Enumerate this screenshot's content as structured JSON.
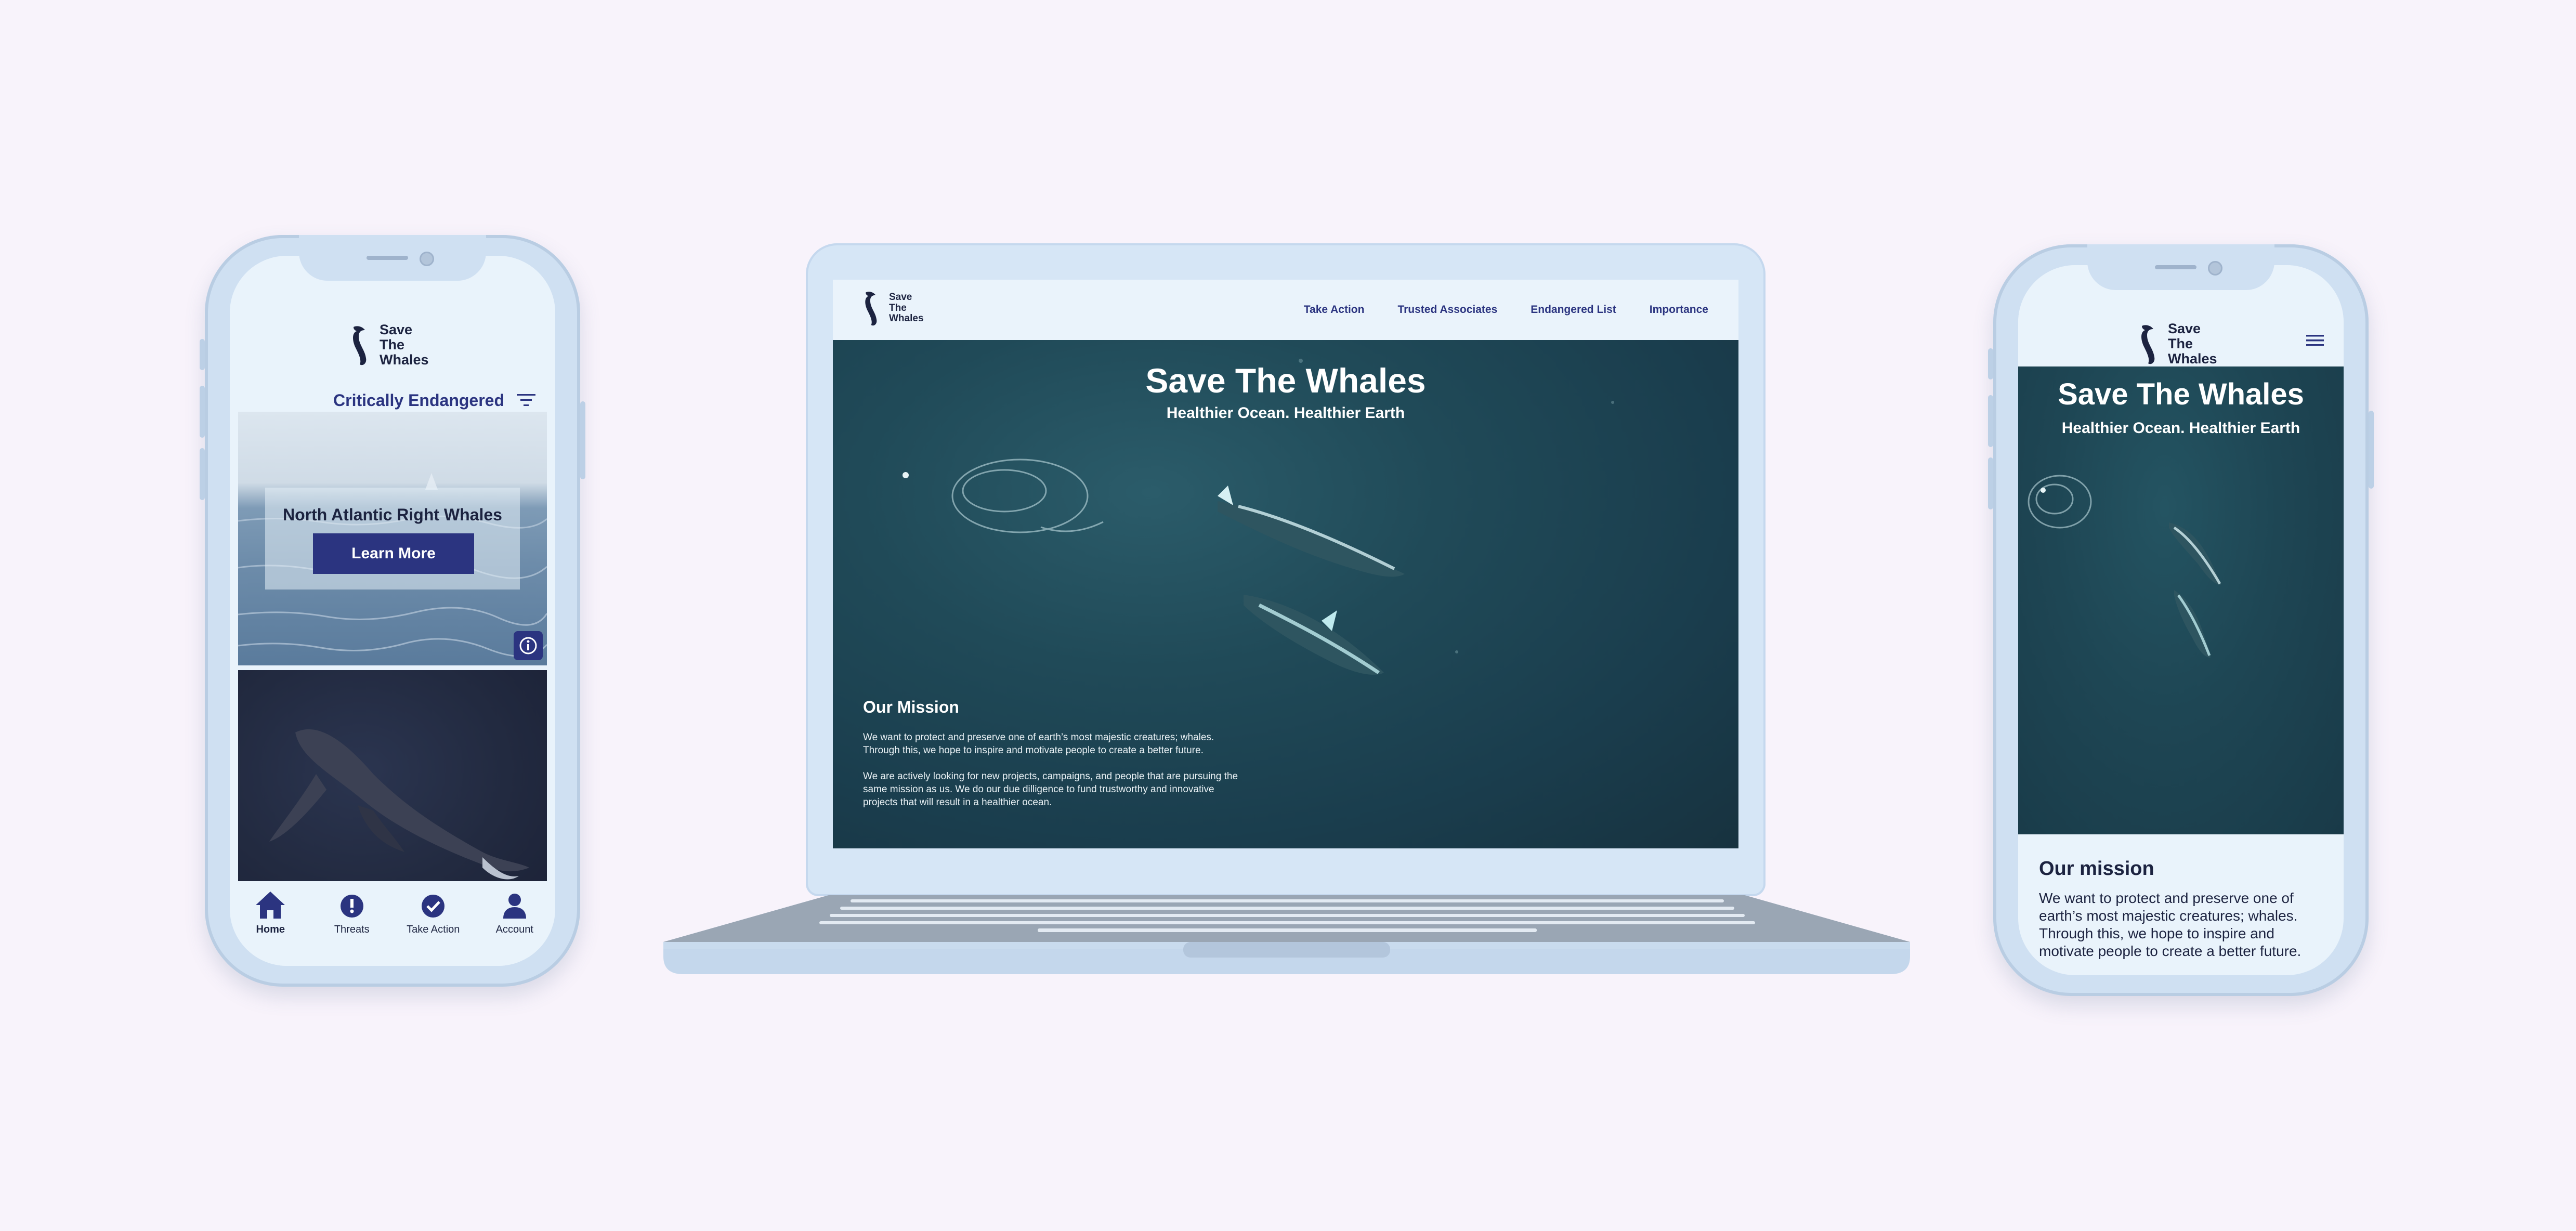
{
  "brand": {
    "line1": "Save",
    "line2": "The",
    "line3": "Whales"
  },
  "mobile_app": {
    "filter_label": "Critically Endangered",
    "card1": {
      "title": "North Atlantic Right Whales",
      "button": "Learn More"
    },
    "nav": [
      {
        "label": "Home",
        "icon": "home-icon",
        "active": true
      },
      {
        "label": "Threats",
        "icon": "alert-icon",
        "active": false
      },
      {
        "label": "Take Action",
        "icon": "check-icon",
        "active": false
      },
      {
        "label": "Account",
        "icon": "user-icon",
        "active": false
      }
    ]
  },
  "desktop": {
    "nav": [
      "Take Action",
      "Trusted Associates",
      "Endangered List",
      "Importance"
    ],
    "hero_title": "Save The Whales",
    "hero_subtitle": "Healthier Ocean. Healthier Earth",
    "mission_title": "Our Mission",
    "mission_p1": "We want to protect and preserve one of earth’s most majestic creatures; whales. Through this, we hope to inspire and motivate people to create a better future.",
    "mission_p2": "We are actively looking for new projects, campaigns, and people that are pursuing the same mission as us. We do our due dilligence to fund trustworthy and innovative projects that will result in a healthier ocean."
  },
  "mobile_web": {
    "hero_title": "Save The Whales",
    "hero_subtitle": "Healthier Ocean. Healthier Earth",
    "mission_title": "Our mission",
    "mission_text": "We want to protect and preserve one of earth’s most majestic creatures; whales. Through this, we hope to inspire and motivate people to create a better future."
  },
  "colors": {
    "primary": "#2b3480",
    "background": "#f8f3fb",
    "device": "#cfe0f2",
    "ocean": "#1e4654"
  }
}
